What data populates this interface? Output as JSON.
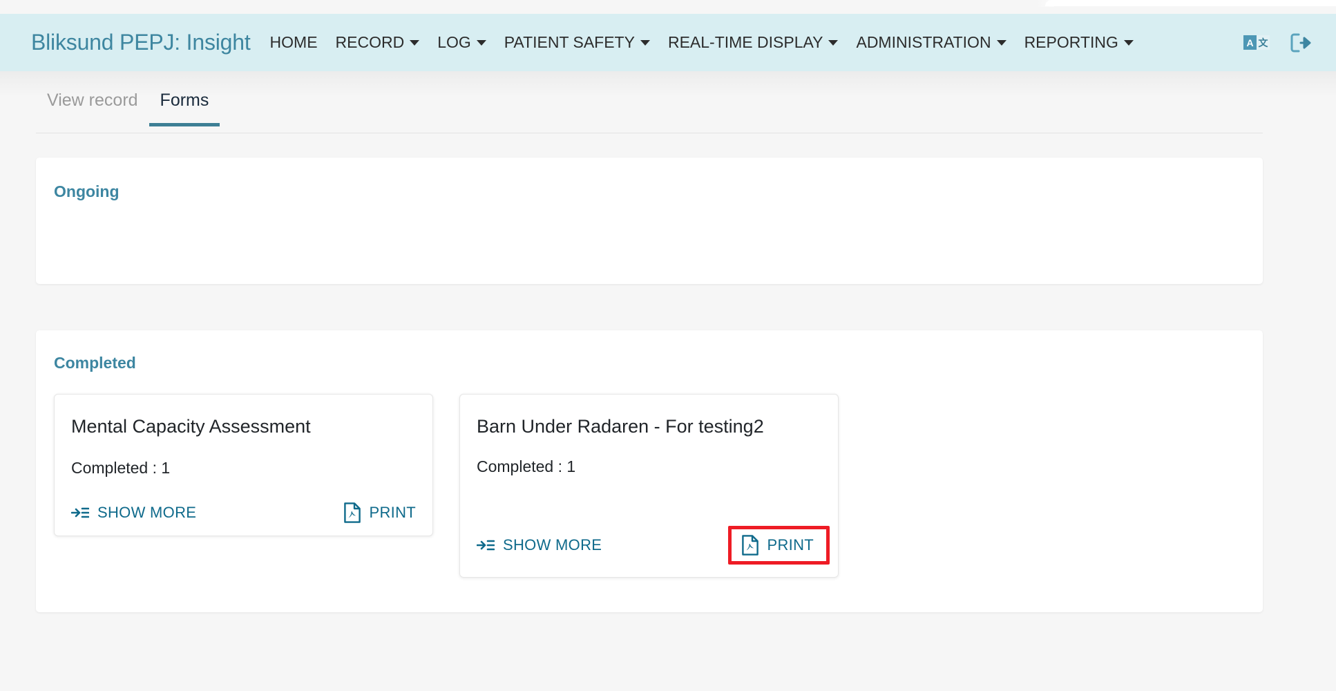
{
  "browser": {
    "tab_visible": true
  },
  "navbar": {
    "brand": "Bliksund PEPJ: Insight",
    "items": [
      {
        "label": "HOME",
        "has_caret": false
      },
      {
        "label": "RECORD",
        "has_caret": true
      },
      {
        "label": "LOG",
        "has_caret": true
      },
      {
        "label": "PATIENT SAFETY",
        "has_caret": true
      },
      {
        "label": "REAL-TIME DISPLAY",
        "has_caret": true
      },
      {
        "label": "ADMINISTRATION",
        "has_caret": true
      },
      {
        "label": "REPORTING",
        "has_caret": true
      }
    ],
    "language_icon": "translate-icon",
    "language_glyph_a": "A",
    "language_glyph_b": "文",
    "logout_icon": "logout-icon",
    "background": "#d8eef2",
    "brand_color": "#3e86a0"
  },
  "tabs": {
    "items": [
      {
        "label": "View record",
        "active": false
      },
      {
        "label": "Forms",
        "active": true
      }
    ],
    "active_underline_color": "#3d7f95"
  },
  "sections": {
    "ongoing": {
      "title": "Ongoing",
      "cards": []
    },
    "completed": {
      "title": "Completed",
      "cards": [
        {
          "title": "Mental Capacity Assessment",
          "meta": "Completed : 1",
          "show_more_label": "SHOW MORE",
          "show_more_icon": "indent-list-icon",
          "print_label": "PRINT",
          "print_icon": "pdf-file-icon",
          "print_highlighted": false
        },
        {
          "title": "Barn Under Radaren - For testing2",
          "meta": "Completed : 1",
          "show_more_label": "SHOW MORE",
          "show_more_icon": "indent-list-icon",
          "print_label": "PRINT",
          "print_icon": "pdf-file-icon",
          "print_highlighted": true
        }
      ]
    }
  },
  "colors": {
    "accent_teal": "#3d86a1",
    "link_teal": "#0f6a8b",
    "highlight_red": "#ee1c25",
    "page_bg": "#f6f6f6",
    "card_bg": "#ffffff"
  }
}
